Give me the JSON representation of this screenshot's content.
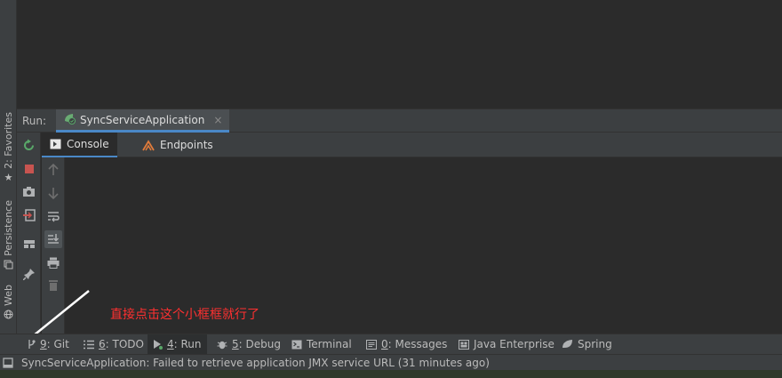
{
  "left_stripe": {
    "favorites_label": "2: Favorites",
    "persistence_label": "Persistence",
    "web_label": "Web"
  },
  "run_window": {
    "run_label": "Run:",
    "tab_label": "SyncServiceApplication",
    "close_glyph": "×",
    "console_tabs": [
      {
        "label": "Console",
        "active": true
      },
      {
        "label": "Endpoints",
        "active": false
      }
    ]
  },
  "annotation": {
    "text": "直接点击这个小框框就行了",
    "color": "#ff3030"
  },
  "bottom_tabs": [
    {
      "number": "9",
      "label": ": Git",
      "icon": "git-icon"
    },
    {
      "number": "6",
      "label": ": TODO",
      "icon": "todo-icon"
    },
    {
      "number": "4",
      "label": ": Run",
      "icon": "run-icon",
      "active": true
    },
    {
      "number": "5",
      "label": ": Debug",
      "icon": "debug-icon"
    },
    {
      "number": "",
      "label": "Terminal",
      "icon": "terminal-icon"
    },
    {
      "number": "0",
      "label": ": Messages",
      "icon": "messages-icon"
    },
    {
      "number": "",
      "label": "Java Enterprise",
      "icon": "java-enterprise-icon"
    },
    {
      "number": "",
      "label": "Spring",
      "icon": "spring-icon"
    }
  ],
  "status_bar": {
    "message": "SyncServiceApplication: Failed to retrieve application JMX service URL (31 minutes ago)"
  },
  "colors": {
    "accent": "#4a88c7",
    "stop_red": "#c75450",
    "rerun_green": "#59a869",
    "spring_green": "#6aab73"
  }
}
